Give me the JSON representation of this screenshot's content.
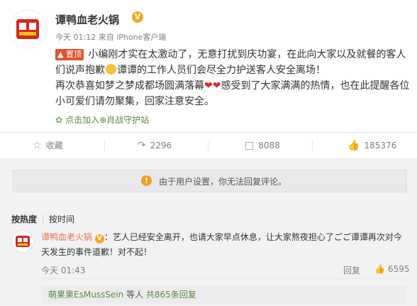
{
  "post": {
    "author": "谭鸭血老火锅",
    "verified_mark": "V",
    "meta": "今天 01:12 来自 iPhone客户端",
    "pin_label": "置顶",
    "text_1": "小编刚才实在太激动了，无意打扰到庆功宴，在此向大家以及就餐的客人们说声抱歉",
    "text_2": "谭谭的工作人员们会尽全力护送客人安全离场！",
    "text_3": "再次恭喜如梦之梦成都场圆满落幕",
    "text_4": "感受到了大家满满的热情，也在此提醒各位小可爱们请勿聚集，回家注意安全。",
    "pin_link": "点击加入⊕肖战守护站"
  },
  "actions": {
    "favorite_label": "收藏",
    "repost_count": "2296",
    "comment_count": "8088",
    "like_count": "185376"
  },
  "notice": {
    "text": "由于用户设置，你无法回复评论。"
  },
  "sort": {
    "hot": "按热度",
    "time": "按时间"
  },
  "comment": {
    "author": "谭鸭血老火锅",
    "verified_mark": "V",
    "text": "：艺人已经安全离开，也请大家早点休息，让大家熬夜担心了ごご谭谭再次对今天发生的事件道歉！对不起！",
    "time": "今天 01:43",
    "reply_label": "回复",
    "like_count": "6595",
    "sub_user": "萌果果EsMussSein",
    "sub_mid": " 等人 ",
    "sub_count": "共865条回复"
  },
  "colors": {
    "accent_orange": "#eb7350",
    "pin_red": "#e2532d",
    "link_green": "#5d8a3a"
  }
}
